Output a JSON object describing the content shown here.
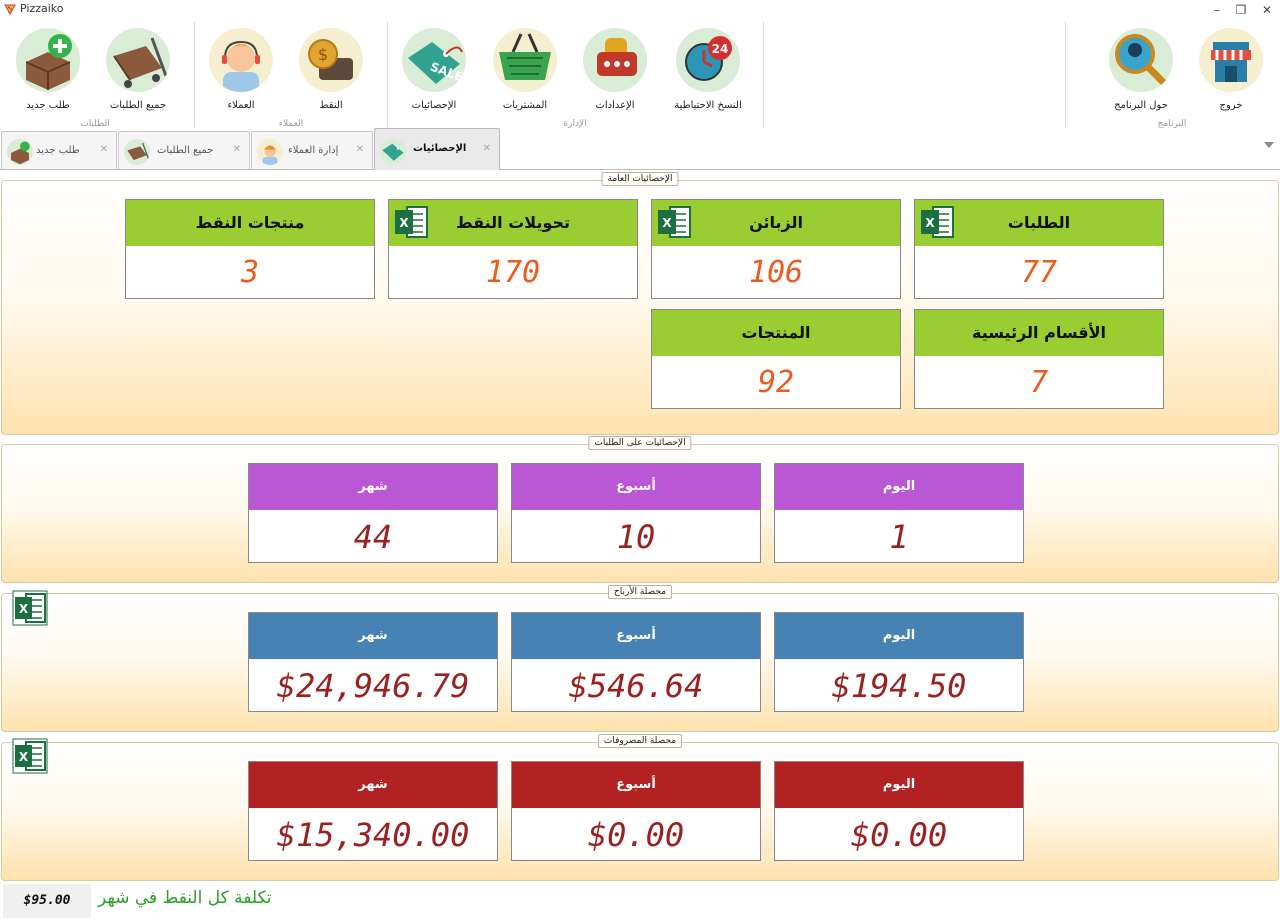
{
  "window": {
    "title": "Pizzaiko",
    "controls": {
      "minimize": "–",
      "restore": "❐",
      "close": "✕"
    }
  },
  "ribbon": {
    "groups": [
      {
        "label": "الطلبات",
        "buttons": [
          {
            "label": "طلب جديد",
            "icon": "new-order-icon"
          },
          {
            "label": "جميع الطلبات",
            "icon": "all-orders-icon"
          }
        ]
      },
      {
        "label": "العملاء",
        "buttons": [
          {
            "label": "العملاء",
            "icon": "customers-icon"
          },
          {
            "label": "النقط",
            "icon": "points-icon"
          }
        ]
      },
      {
        "label": "الإدارة",
        "buttons": [
          {
            "label": "الإحصائيات",
            "icon": "statistics-icon"
          },
          {
            "label": "المشتريات",
            "icon": "purchases-icon"
          },
          {
            "label": "الإعدادات",
            "icon": "settings-icon"
          },
          {
            "label": "النسخ الاحتياطية",
            "icon": "backup-icon"
          }
        ]
      },
      {
        "label": "البرنامج",
        "buttons": [
          {
            "label": "حول البرنامج",
            "icon": "about-icon"
          },
          {
            "label": "خروج",
            "icon": "exit-icon"
          }
        ]
      }
    ]
  },
  "tabs": [
    {
      "label": "طلب جديد",
      "close": "✕",
      "active": false
    },
    {
      "label": "جميع الطلبات",
      "close": "✕",
      "active": false
    },
    {
      "label": "إدارة العملاء",
      "close": "✕",
      "active": false
    },
    {
      "label": "الإحصائيات",
      "close": "✕",
      "active": true
    }
  ],
  "general_stats": {
    "legend": "الإحصائيات العامة",
    "cards": [
      {
        "title": "الطلبات",
        "value": "77",
        "excel": true
      },
      {
        "title": "الزبائن",
        "value": "106",
        "excel": true
      },
      {
        "title": "تحويلات النقط",
        "value": "170",
        "excel": true
      },
      {
        "title": "منتجات النقط",
        "value": "3",
        "excel": false
      },
      {
        "title": "الأقسام الرئيسية",
        "value": "7",
        "excel": false
      },
      {
        "title": "المنتجات",
        "value": "92",
        "excel": false
      }
    ],
    "header_color": "#9acd32",
    "value_color": "#ee5a1e"
  },
  "orders_stats": {
    "legend": "الإحصائيات على الطلبات",
    "cards": [
      {
        "title": "اليوم",
        "value": "1"
      },
      {
        "title": "أسبوع",
        "value": "10"
      },
      {
        "title": "شهر",
        "value": "44"
      }
    ],
    "header_color": "#b957d4"
  },
  "profits": {
    "legend": "محصلة الأرباح",
    "cards": [
      {
        "title": "اليوم",
        "value": "$194.50"
      },
      {
        "title": "أسبوع",
        "value": "$546.64"
      },
      {
        "title": "شهر",
        "value": "$24,946.79"
      }
    ],
    "header_color": "#4682b4"
  },
  "expenses": {
    "legend": "محصلة المصروفات",
    "cards": [
      {
        "title": "اليوم",
        "value": "$0.00"
      },
      {
        "title": "أسبوع",
        "value": "$0.00"
      },
      {
        "title": "شهر",
        "value": "$15,340.00"
      }
    ],
    "header_color": "#b22222"
  },
  "status": {
    "cost_value": "$95.00",
    "cost_label": "تكلفة كل النقط في شهر"
  },
  "excel_icon_letter": "X"
}
